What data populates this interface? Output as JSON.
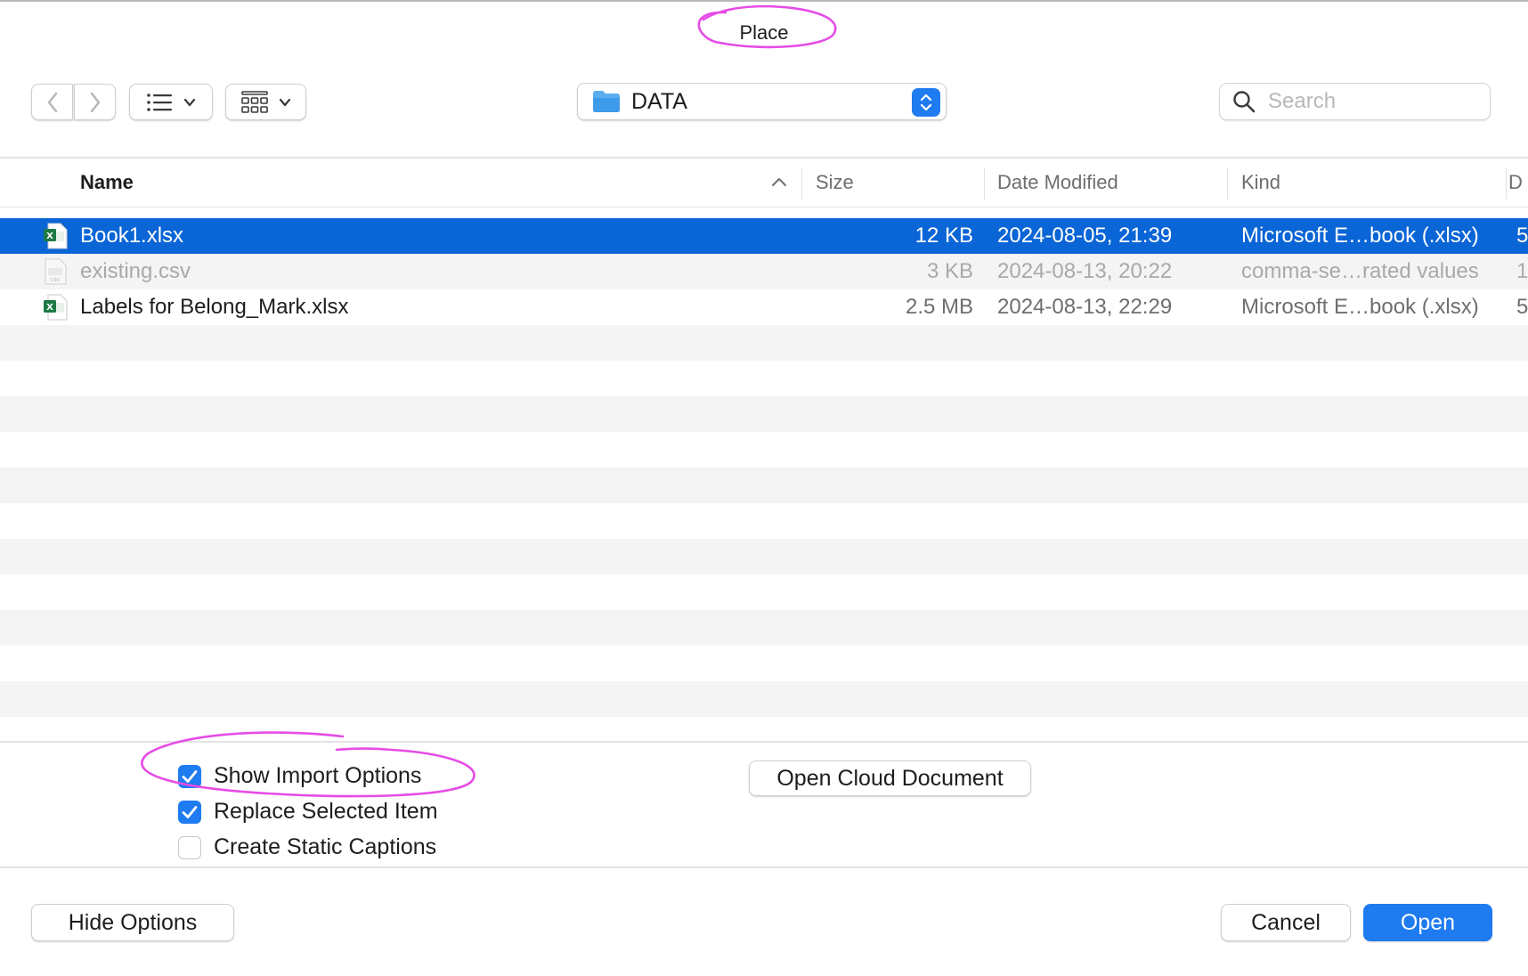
{
  "dialog": {
    "title": "Place"
  },
  "toolbar": {
    "back_icon": "chevron-left-icon",
    "forward_icon": "chevron-right-icon",
    "list_view_icon": "list-view-icon",
    "grid_view_icon": "grid-view-icon",
    "path": {
      "folder_name": "DATA",
      "icon": "folder-icon"
    },
    "search": {
      "placeholder": "Search"
    }
  },
  "file_list": {
    "columns": {
      "name": "Name",
      "size": "Size",
      "date_modified": "Date Modified",
      "kind": "Kind",
      "truncated": "D"
    },
    "sort": {
      "column": "name",
      "direction": "ascending"
    },
    "rows": [
      {
        "name": "Book1.xlsx",
        "size": "12 KB",
        "date": "2024-08-05, 21:39",
        "kind": "Microsoft E…book (.xlsx)",
        "extra": "5",
        "icon": "excel-file-icon",
        "selected": true,
        "disabled": false
      },
      {
        "name": "existing.csv",
        "size": "3 KB",
        "date": "2024-08-13, 20:22",
        "kind": "comma-se…rated values",
        "extra": "1",
        "icon": "csv-file-icon",
        "selected": false,
        "disabled": true
      },
      {
        "name": "Labels for Belong_Mark.xlsx",
        "size": "2.5 MB",
        "date": "2024-08-13, 22:29",
        "kind": "Microsoft E…book (.xlsx)",
        "extra": "5",
        "icon": "excel-file-icon",
        "selected": false,
        "disabled": false
      }
    ]
  },
  "options": {
    "show_import_options": {
      "label": "Show Import Options",
      "checked": true
    },
    "replace_selected_item": {
      "label": "Replace Selected Item",
      "checked": true
    },
    "create_static_captions": {
      "label": "Create Static Captions",
      "checked": false
    },
    "open_cloud_document": "Open Cloud Document"
  },
  "footer": {
    "hide_options": "Hide Options",
    "cancel": "Cancel",
    "open": "Open"
  },
  "colors": {
    "accent": "#1f7bf0",
    "selection": "#0a65d6",
    "annotation": "#e64ce6",
    "excel_green": "#1d7a45"
  }
}
